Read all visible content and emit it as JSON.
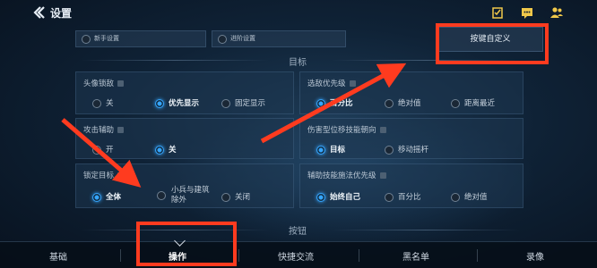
{
  "header": {
    "title": "设置",
    "icons": [
      "back-icon",
      "task-icon",
      "chat-icon",
      "friends-icon"
    ]
  },
  "presets": {
    "left": "新手设置",
    "right": "进阶设置",
    "custom_button": "按键自定义"
  },
  "sections": {
    "target": "目标",
    "buttons": "按钮"
  },
  "cards": [
    {
      "title": "头像锁敌",
      "options": [
        "关",
        "优先显示",
        "固定显示"
      ],
      "selected": 1
    },
    {
      "title": "选敌优先级",
      "options": [
        "百分比",
        "绝对值",
        "距离最近"
      ],
      "selected": 0
    },
    {
      "title": "攻击辅助",
      "options": [
        "开",
        "关"
      ],
      "selected": 1
    },
    {
      "title": "伤害型位移技能朝向",
      "options": [
        "目标",
        "移动摇杆"
      ],
      "selected": 0
    },
    {
      "title": "锁定目标",
      "options": [
        "全体",
        "小兵与建筑除外",
        "关闭"
      ],
      "option_lines": [
        "小兵与建筑",
        "除外"
      ],
      "selected": 0
    },
    {
      "title": "辅助技能施法优先级",
      "options": [
        "始终自己",
        "百分比",
        "绝对值"
      ],
      "selected": 0
    }
  ],
  "tabs": [
    "基础",
    "操作",
    "快捷交流",
    "黑名单",
    "录像"
  ],
  "active_tab": 1,
  "colors": {
    "accent": "#36a6ff",
    "annotation": "#ff3b1f"
  }
}
